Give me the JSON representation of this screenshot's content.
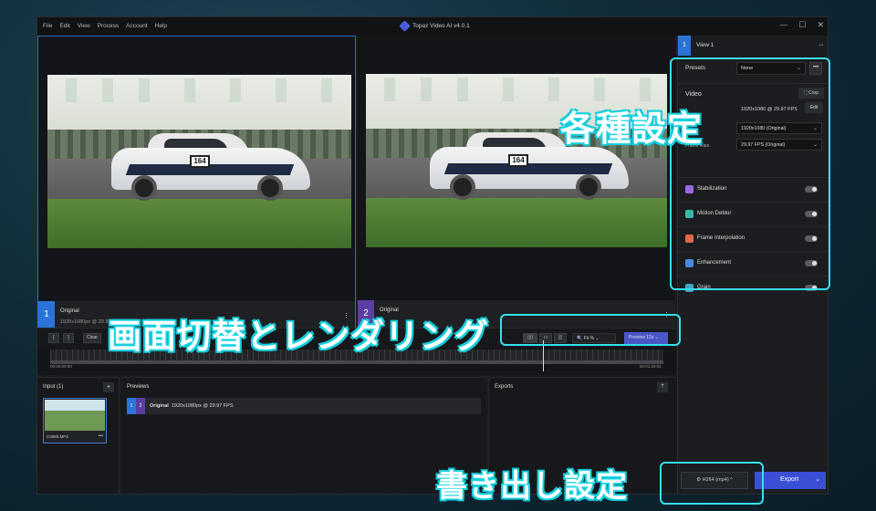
{
  "menu": [
    "File",
    "Edit",
    "View",
    "Process",
    "Account",
    "Help"
  ],
  "app_title": "Topaz Video AI  v4.0.1",
  "window_controls": [
    "—",
    "☐",
    "✕"
  ],
  "car_number": "164",
  "left_pane": {
    "number": "1",
    "title": "Original",
    "subtitle": "1920x1080px @ 29.97 FPS",
    "more": "⋮"
  },
  "right_pane": {
    "number": "2",
    "title": "Original",
    "subtitle": "",
    "more": "⋮"
  },
  "side": {
    "view_num": "1",
    "view_label": "View 1",
    "expand_icon": "⇔",
    "presets_label": "Presets",
    "presets_value": "None",
    "more": "•••",
    "video_label": "Video",
    "crop_label": "Crop",
    "input_res": "1920x1080 @ 29.97 FPS",
    "edit_label": "Edit",
    "res_label": "tion",
    "res_value": "1920x1080 (Original)",
    "fps_label": "Frame Rate",
    "fps_value": "29.97 FPS (Original)",
    "features": [
      {
        "label": "Stabilization",
        "color": "#9a6be0"
      },
      {
        "label": "Motion Deblur",
        "color": "#37b8a8"
      },
      {
        "label": "Frame Interpolation",
        "color": "#e06a4a"
      },
      {
        "label": "Enhancement",
        "color": "#4a8ae0"
      },
      {
        "label": "Grain",
        "color": "#3aa8c8"
      }
    ]
  },
  "controls": {
    "clear": "Clear",
    "zoom": "Fit %",
    "preview": "Preview 12s"
  },
  "timeline": {
    "start": "00:00:00:00",
    "end": "00:01:20:01"
  },
  "input": {
    "label": "Input (1)",
    "add": "+",
    "file": "C0080.MP4",
    "more": "•••"
  },
  "previews": {
    "label": "Previews",
    "row_title": "Original",
    "row_info": "1920x1080px @ 29.97 FPS",
    "n1": "1",
    "n2": "2"
  },
  "exports": {
    "label": "Exports",
    "icon": "⇡"
  },
  "format": "H264 (mp4) ^",
  "export_label": "Export",
  "annotations": {
    "settings": "各種設定",
    "view_render": "画面切替とレンダリング",
    "export_settings": "書き出し設定"
  }
}
